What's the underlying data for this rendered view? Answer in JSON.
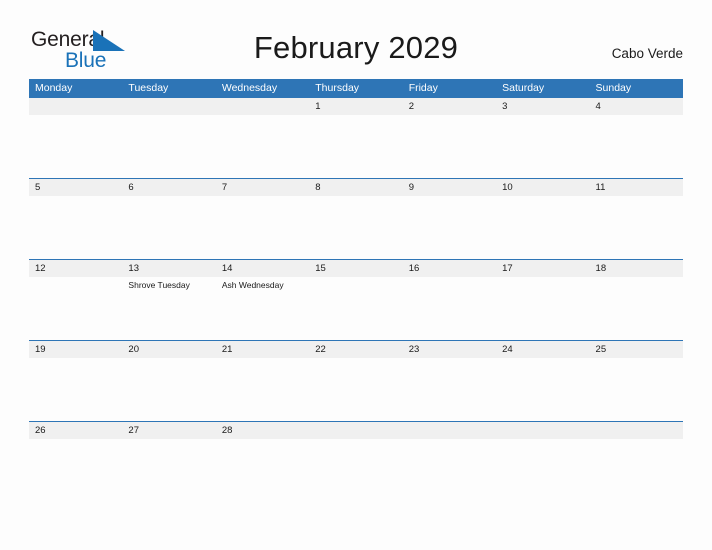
{
  "brand": {
    "name_part1": "General",
    "name_part2": "Blue",
    "flag_icon": "triangle-flag-icon",
    "color_dark": "#231f20",
    "color_blue": "#1a72b8"
  },
  "header": {
    "title": "February 2029",
    "country": "Cabo Verde"
  },
  "theme": {
    "header_blue": "#2e75b6",
    "band_gray": "#f0f0f0",
    "page_background": "#fdfdfd",
    "text_dark": "#1a1a1a"
  },
  "calendar": {
    "month": "February",
    "year": "2029",
    "weekdays": [
      "Monday",
      "Tuesday",
      "Wednesday",
      "Thursday",
      "Friday",
      "Saturday",
      "Sunday"
    ],
    "weeks": [
      {
        "days": [
          {
            "num": "",
            "event": ""
          },
          {
            "num": "",
            "event": ""
          },
          {
            "num": "",
            "event": ""
          },
          {
            "num": "1",
            "event": ""
          },
          {
            "num": "2",
            "event": ""
          },
          {
            "num": "3",
            "event": ""
          },
          {
            "num": "4",
            "event": ""
          }
        ]
      },
      {
        "days": [
          {
            "num": "5",
            "event": ""
          },
          {
            "num": "6",
            "event": ""
          },
          {
            "num": "7",
            "event": ""
          },
          {
            "num": "8",
            "event": ""
          },
          {
            "num": "9",
            "event": ""
          },
          {
            "num": "10",
            "event": ""
          },
          {
            "num": "11",
            "event": ""
          }
        ]
      },
      {
        "days": [
          {
            "num": "12",
            "event": ""
          },
          {
            "num": "13",
            "event": "Shrove Tuesday"
          },
          {
            "num": "14",
            "event": "Ash Wednesday"
          },
          {
            "num": "15",
            "event": ""
          },
          {
            "num": "16",
            "event": ""
          },
          {
            "num": "17",
            "event": ""
          },
          {
            "num": "18",
            "event": ""
          }
        ]
      },
      {
        "days": [
          {
            "num": "19",
            "event": ""
          },
          {
            "num": "20",
            "event": ""
          },
          {
            "num": "21",
            "event": ""
          },
          {
            "num": "22",
            "event": ""
          },
          {
            "num": "23",
            "event": ""
          },
          {
            "num": "24",
            "event": ""
          },
          {
            "num": "25",
            "event": ""
          }
        ]
      },
      {
        "days": [
          {
            "num": "26",
            "event": ""
          },
          {
            "num": "27",
            "event": ""
          },
          {
            "num": "28",
            "event": ""
          },
          {
            "num": "",
            "event": ""
          },
          {
            "num": "",
            "event": ""
          },
          {
            "num": "",
            "event": ""
          },
          {
            "num": "",
            "event": ""
          }
        ]
      }
    ]
  }
}
